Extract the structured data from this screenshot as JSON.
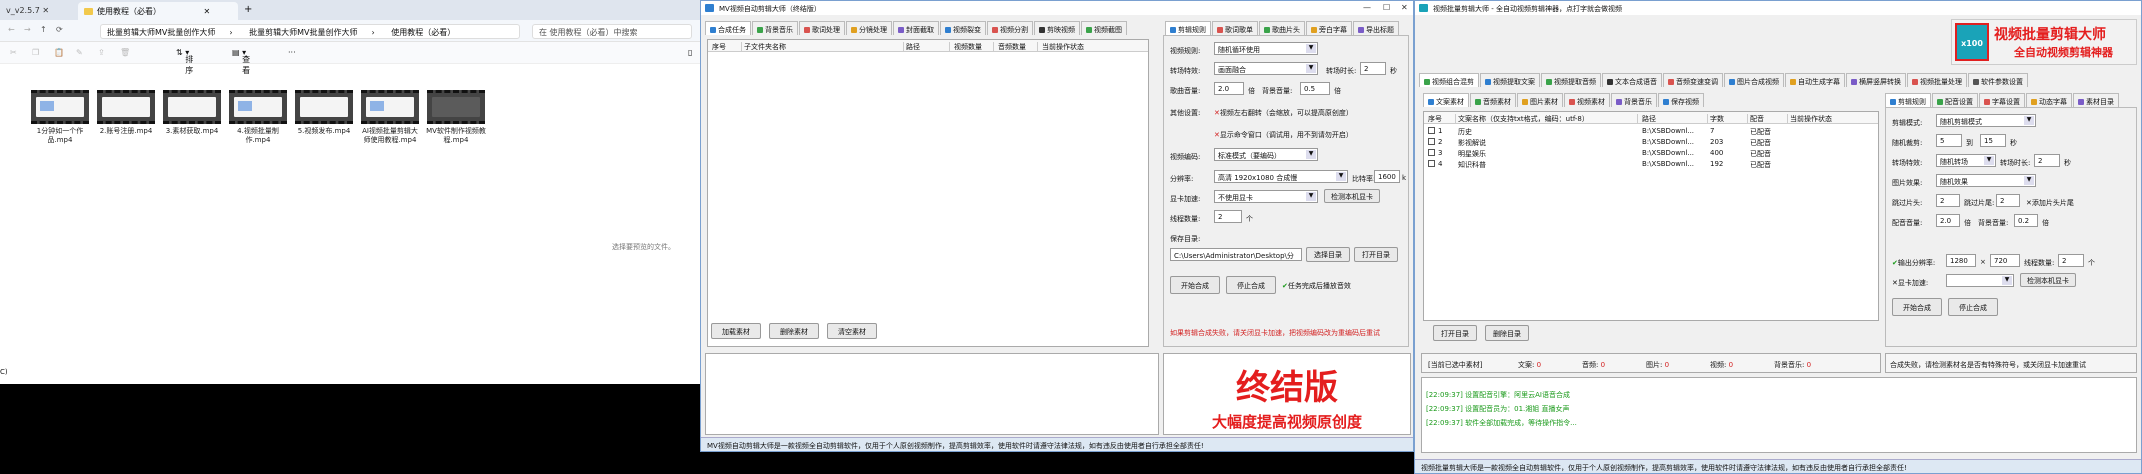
{
  "explorer": {
    "left_tab": "v_v2.5.7",
    "active_tab": "使用教程（必看）",
    "breadcrumbs": [
      "批量剪辑大师MV批量创作大师",
      "批量剪辑大师MV批量创作大师",
      "使用教程（必看）"
    ],
    "search_placeholder": "在 使用教程（必看）中搜索",
    "toolbar": {
      "sort": "排序",
      "view": "查看",
      "more": "···"
    },
    "files": [
      "1分钟如一个作品.mp4",
      "2.账号注册.mp4",
      "3.素材获取.mp4",
      "4.视频批量制作.mp4",
      "5.视频发布.mp4",
      "AI视频批量剪辑大师使用教程.mp4",
      "MV软件制作视频教程.mp4"
    ],
    "empty_note": "选择要预览的文件。",
    "bottom_left": "C)"
  },
  "mv": {
    "title": "MV视频自动剪辑大师（终结版）",
    "tabs": [
      "合成任务",
      "背景音乐",
      "歌词处理",
      "分镜处理",
      "封面截取",
      "视频裂变",
      "视频分割",
      "剪映视频",
      "视频截图"
    ],
    "columns": [
      "序号",
      "子文件夹名称",
      "路径",
      "视频数量",
      "音频数量",
      "当前操作状态"
    ],
    "buttons": {
      "add": "加载素材",
      "delete": "删除素材",
      "clear": "清空素材"
    },
    "right_tabs": [
      "剪辑规则",
      "歌词歌单",
      "歌曲片头",
      "旁白字幕",
      "导出标题"
    ],
    "form": {
      "video_rule_label": "视频规则:",
      "video_rule": "随机循环使用",
      "transition_label": "转场特效:",
      "transition": "画面融合",
      "transition_time_label": "转场时长:",
      "transition_time": "2",
      "sec": "秒",
      "lyrics_vol_label": "歌曲音量:",
      "lyrics_vol": "2.0",
      "bg_vol_label": "背景音量:",
      "bg_vol": "0.5",
      "times": "倍",
      "other_label": "其他设置:",
      "opt1": "视频左右翻转（会缩放，可以提高原创度）",
      "opt2": "显示命令窗口（调试用，用不到请勿开启）",
      "codec_label": "视频编码:",
      "codec": "标准模式（要编码）",
      "res_label": "分辨率:",
      "res": "高清 1920x1080 合成慢",
      "bitrate_label": "比特率:",
      "bitrate": "1600",
      "bitrate_unit": "k",
      "gpu_label": "显卡加速:",
      "gpu": "不使用显卡",
      "gpu_btn": "检测本机显卡",
      "threads_label": "线程数量:",
      "threads": "2",
      "threads_unit": "个",
      "save_label": "保存目录:",
      "save_path": "C:\\Users\\Administrator\\Desktop\\分",
      "choose_dir": "选择目录",
      "open_dir": "打开目录",
      "start": "开始合成",
      "stop": "停止合成",
      "auto_shutdown": "任务完成后播放音效",
      "warning": "如果剪辑合成失败，请关闭显卡加速，把视频编码改为重编码后重试"
    },
    "banner": {
      "title": "终结版",
      "subtitle": "大幅度提高视频原创度"
    },
    "status": "MV视频自动剪辑大师是一款视频全自动剪辑软件，仅用于个人原创视频制作，提高剪辑效率，使用软件时请遵守法律法规，如有违反由使用者自行承担全部责任!"
  },
  "batch": {
    "title": "视频批量剪辑大师 - 全自动视频剪辑神器，点打字就会做视频",
    "logo": {
      "badge": "x100",
      "title": "视频批量剪辑大师",
      "subtitle": "全自动视频剪辑神器"
    },
    "tabs": [
      "视频组合混剪",
      "视频提取文案",
      "视频提取音频",
      "文本合成语音",
      "音频变速变调",
      "图片合成视频",
      "自动生成字幕",
      "横屏竖屏转换",
      "视频批量处理",
      "软件参数设置"
    ],
    "subtabs": [
      "文案素材",
      "音频素材",
      "图片素材",
      "视频素材",
      "背景音乐",
      "保存视频"
    ],
    "columns": [
      "序号",
      "文案名称（仅支持txt格式，编码：utf-8）",
      "路径",
      "字数",
      "配音",
      "当前操作状态"
    ],
    "rows": [
      {
        "no": "1",
        "name": "历史",
        "path": "B:\\XSBDownl...",
        "count": "7",
        "status": "已配音"
      },
      {
        "no": "2",
        "name": "影视解说",
        "path": "B:\\XSBDownl...",
        "count": "203",
        "status": "已配音"
      },
      {
        "no": "3",
        "name": "明星娱乐",
        "path": "B:\\XSBDownl...",
        "count": "400",
        "status": "已配音"
      },
      {
        "no": "4",
        "name": "知识科普",
        "path": "B:\\XSBDownl...",
        "count": "192",
        "status": "已配音"
      }
    ],
    "buttons": {
      "open_dir": "打开目录",
      "delete": "删除目录"
    },
    "selected_label": "[当前已选中素材]",
    "counts": [
      {
        "label": "文案:",
        "value": "0"
      },
      {
        "label": "音频:",
        "value": "0"
      },
      {
        "label": "图片:",
        "value": "0"
      },
      {
        "label": "视频:",
        "value": "0"
      },
      {
        "label": "背景音乐:",
        "value": "0"
      }
    ],
    "log": [
      "[22:09:37] 设置配音引擎：阿里云AI语音合成",
      "[22:09:37] 设置配音员为：01.湘姐 直播女声",
      "[22:09:37] 软件全部加载完成，等待操作指令..."
    ],
    "right_tabs": [
      "剪辑规则",
      "配音设置",
      "字幕设置",
      "动态字幕",
      "素材目录"
    ],
    "form": {
      "mode_label": "剪辑模式:",
      "mode": "随机剪辑模式",
      "random_dur_label": "随机裁剪:",
      "dur_from": "5",
      "to": "到",
      "dur_to": "15",
      "sec": "秒",
      "transition_label": "转场特效:",
      "transition": "随机转场",
      "transition_time_label": "转场时长:",
      "transition_time": "2",
      "image_fx_label": "图片效果:",
      "image_fx": "随机效果",
      "skip_head_label": "跳过片头:",
      "skip_head": "2",
      "skip_tail_label": "跳过片尾:",
      "skip_tail": "2",
      "add_tail": "添加片头片尾",
      "voice_vol_label": "配音音量:",
      "voice_vol": "2.0",
      "bg_vol_label": "背景音量:",
      "bg_vol": "0.2",
      "times": "倍",
      "res_label": "输出分辨率:",
      "res_w": "1280",
      "x": "×",
      "res_h": "720",
      "threads_label": "线程数量:",
      "threads": "2",
      "threads_unit": "个",
      "gpu_label": "显卡加速:",
      "gpu_btn": "检测本机显卡",
      "start": "开始合成",
      "stop": "停止合成",
      "warning": "合成失败，请检测素材名是否有特殊符号，或关闭显卡加速重试"
    },
    "status": "视频批量剪辑大师是一款视频全自动剪辑软件，仅用于个人原创视频制作，提高剪辑效率，使用软件时请遵守法律法规，如有违反由使用者自行承担全部责任!"
  }
}
